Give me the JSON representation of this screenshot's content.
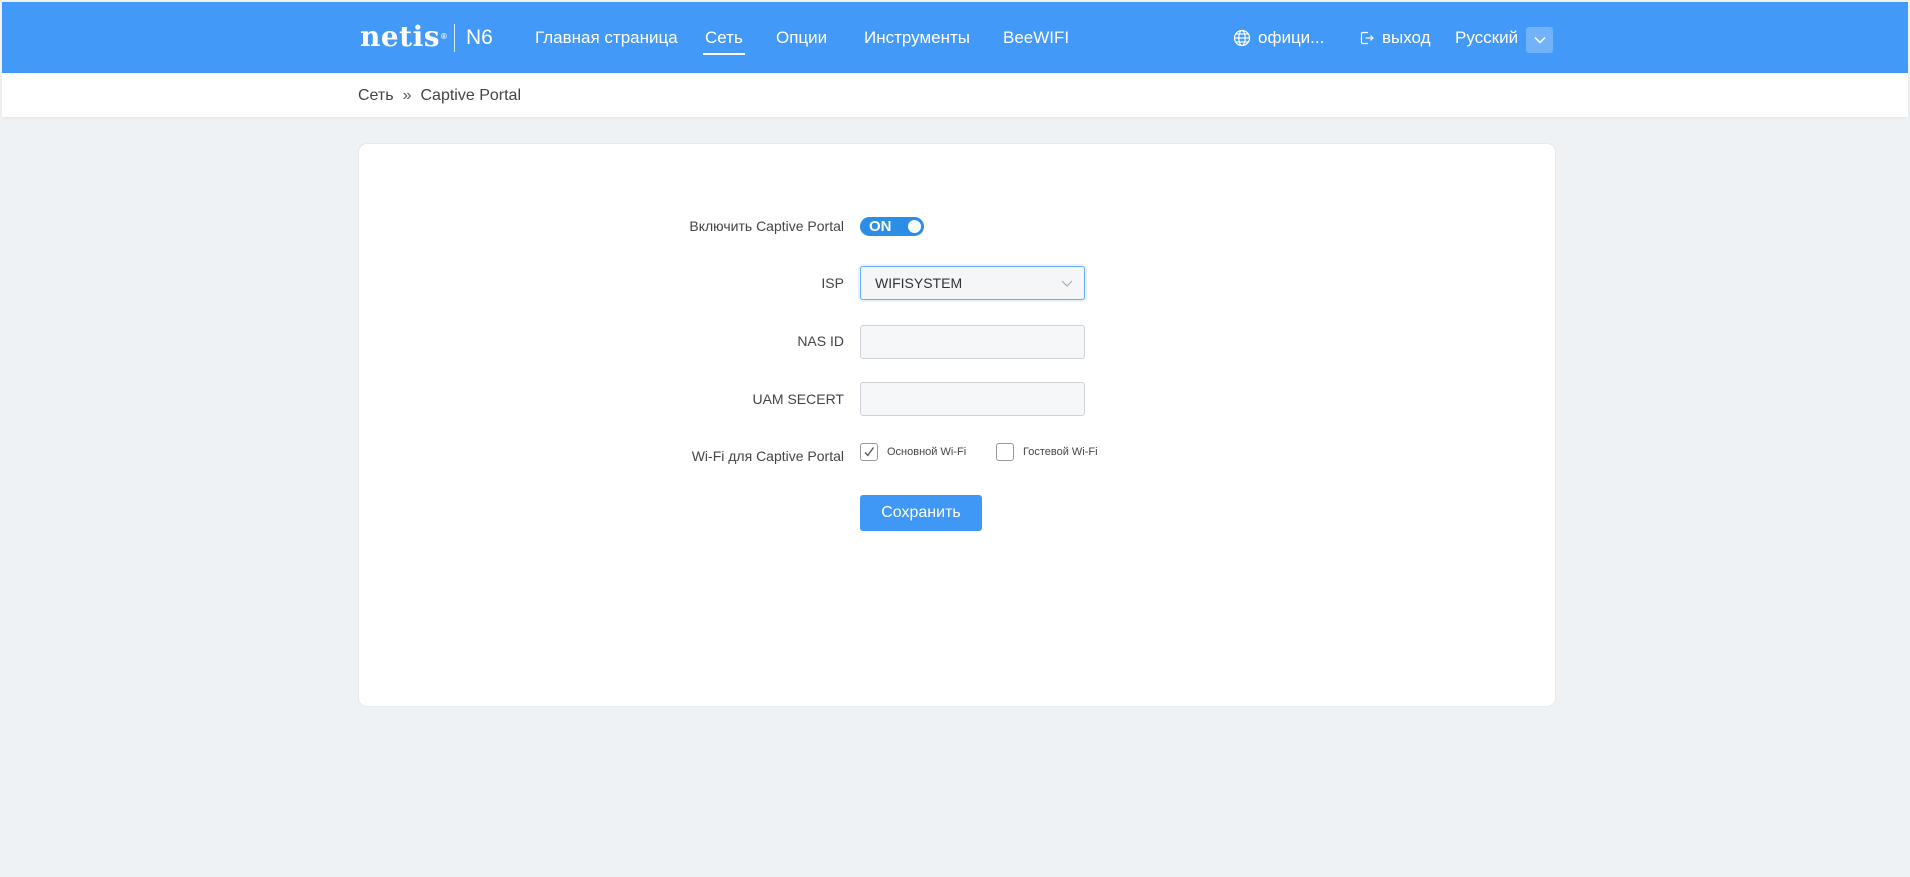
{
  "brand": {
    "logo": "netis",
    "registered": "®",
    "model": "N6"
  },
  "nav": {
    "items": [
      {
        "label": "Главная страница",
        "active": false
      },
      {
        "label": "Сеть",
        "active": true
      },
      {
        "label": "Опции",
        "active": false
      },
      {
        "label": "Инструменты",
        "active": false
      },
      {
        "label": "BeeWIFI",
        "active": false
      }
    ],
    "official_label": "офици...",
    "logout_label": "выход",
    "language": "Русский"
  },
  "breadcrumb": {
    "parent": "Сеть",
    "separator": "»",
    "current": "Captive Portal"
  },
  "form": {
    "enable_label": "Включить Captive Portal",
    "enable_state": "ON",
    "isp_label": "ISP",
    "isp_value": "WIFISYSTEM",
    "nas_label": "NAS ID",
    "nas_value": "",
    "uam_label": "UAM SECERT",
    "uam_value": "",
    "wifi_label": "Wi-Fi для Captive Portal",
    "wifi_options": [
      {
        "label": "Основной Wi-Fi",
        "checked": true
      },
      {
        "label": "Гостевой Wi-Fi",
        "checked": false
      }
    ],
    "save_label": "Сохранить"
  },
  "colors": {
    "header": "#4299f7",
    "accent": "#3f98f5",
    "toggle": "#2a8ee6",
    "background": "#eff2f5"
  }
}
